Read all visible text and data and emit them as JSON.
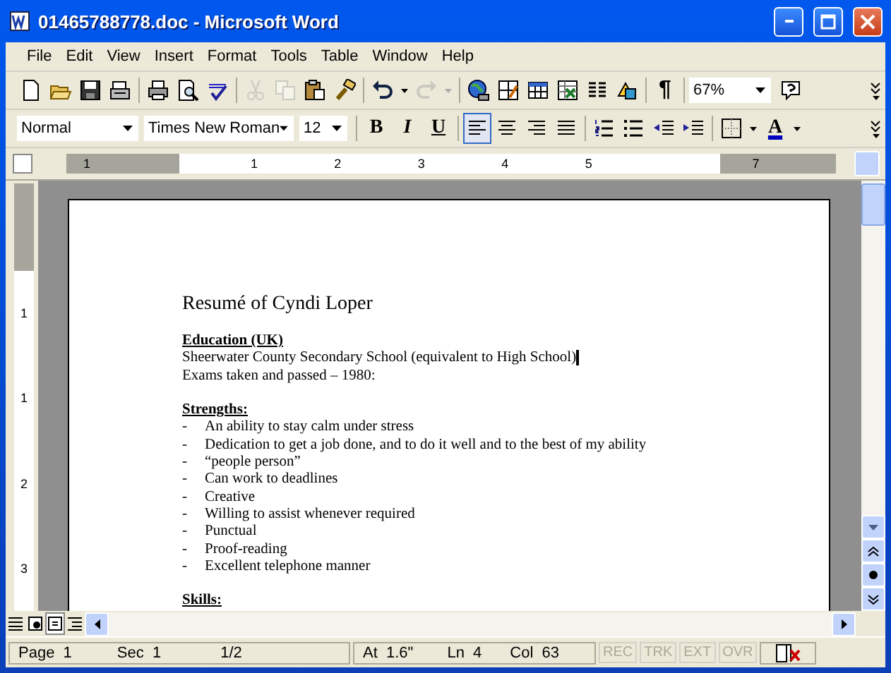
{
  "window": {
    "title": "01465788778.doc - Microsoft Word"
  },
  "menu": [
    {
      "label": "File"
    },
    {
      "label": "Edit"
    },
    {
      "label": "View"
    },
    {
      "label": "Insert"
    },
    {
      "label": "Format"
    },
    {
      "label": "Tools"
    },
    {
      "label": "Table"
    },
    {
      "label": "Window"
    },
    {
      "label": "Help"
    }
  ],
  "standard_toolbar": {
    "groups": [
      [
        {
          "kind": "new",
          "disabled": false
        },
        {
          "kind": "open",
          "disabled": false
        },
        {
          "kind": "save",
          "disabled": false
        },
        {
          "kind": "email",
          "disabled": false
        }
      ],
      [
        {
          "kind": "print",
          "disabled": false
        },
        {
          "kind": "preview",
          "disabled": false
        },
        {
          "kind": "spelling",
          "disabled": false
        }
      ],
      [
        {
          "kind": "cut",
          "disabled": true
        },
        {
          "kind": "copy",
          "disabled": true
        },
        {
          "kind": "paste",
          "disabled": false
        },
        {
          "kind": "painter",
          "disabled": false
        }
      ],
      [
        {
          "kind": "undo",
          "disabled": false
        },
        {
          "kind": "redo",
          "disabled": true
        }
      ],
      [
        {
          "kind": "globe",
          "disabled": false
        },
        {
          "kind": "draw-table",
          "disabled": false
        },
        {
          "kind": "table",
          "disabled": false
        },
        {
          "kind": "sheet",
          "disabled": false
        },
        {
          "kind": "columns",
          "disabled": false
        },
        {
          "kind": "drawing",
          "disabled": false
        }
      ]
    ],
    "pilcrow": "¶",
    "zoom": "67%"
  },
  "formatting_toolbar": {
    "style": "Normal",
    "font": "Times New Roman",
    "size": "12",
    "groups": [
      [
        {
          "kind": "bold",
          "label": "B",
          "selected": false
        },
        {
          "kind": "italic",
          "label": "I",
          "selected": false
        },
        {
          "kind": "underline",
          "label": "U",
          "selected": false
        }
      ],
      [
        {
          "kind": "align-left",
          "selected": true
        },
        {
          "kind": "align-center",
          "selected": false
        },
        {
          "kind": "align-right",
          "selected": false
        },
        {
          "kind": "justify",
          "selected": false
        }
      ],
      [
        {
          "kind": "numbering",
          "selected": false
        },
        {
          "kind": "bullets",
          "selected": false
        },
        {
          "kind": "outdent",
          "selected": false
        },
        {
          "kind": "indent",
          "selected": false
        }
      ],
      [
        {
          "kind": "borders",
          "selected": false
        },
        {
          "kind": "font-color",
          "label": "A",
          "selected": false
        }
      ]
    ]
  },
  "ruler": {
    "labels": [
      "1",
      "1",
      "2",
      "3",
      "4",
      "5",
      "7"
    ],
    "vertical_labels": [
      "1",
      "1",
      "2",
      "3"
    ]
  },
  "document": {
    "title": "Resumé of Cyndi Loper",
    "sections": [
      {
        "heading": "Education (UK)",
        "lines": [
          {
            "kind": "text",
            "text": "Sheerwater County Secondary School (equivalent to High School)"
          },
          {
            "kind": "text",
            "text": "Exams taken and passed – 1980:"
          }
        ]
      },
      {
        "heading": "Strengths:",
        "lines": [
          {
            "kind": "bullet",
            "marker": "-",
            "text": "An ability to stay calm under stress"
          },
          {
            "kind": "bullet",
            "marker": "-",
            "text": "Dedication to get a job done, and to do it well and to the best of my ability"
          },
          {
            "kind": "bullet",
            "marker": "-",
            "text": "“people person”"
          },
          {
            "kind": "bullet",
            "marker": "-",
            "text": "Can work to deadlines"
          },
          {
            "kind": "bullet",
            "marker": "-",
            "text": "Creative"
          },
          {
            "kind": "bullet",
            "marker": "-",
            "text": "Willing to assist whenever required"
          },
          {
            "kind": "bullet",
            "marker": "-",
            "text": "Punctual"
          },
          {
            "kind": "bullet",
            "marker": "-",
            "text": "Proof-reading"
          },
          {
            "kind": "bullet",
            "marker": "-",
            "text": "Excellent telephone manner"
          }
        ]
      },
      {
        "heading": "Skills:"
      }
    ]
  },
  "status_bar": {
    "page": "Page  1",
    "sec": "Sec  1",
    "pages": "1/2",
    "at": "At  1.6\"",
    "ln": "Ln  4",
    "col": "Col  63",
    "modes": [
      {
        "label": "REC",
        "on": false
      },
      {
        "label": "TRK",
        "on": false
      },
      {
        "label": "EXT",
        "on": false
      },
      {
        "label": "OVR",
        "on": false
      }
    ]
  }
}
